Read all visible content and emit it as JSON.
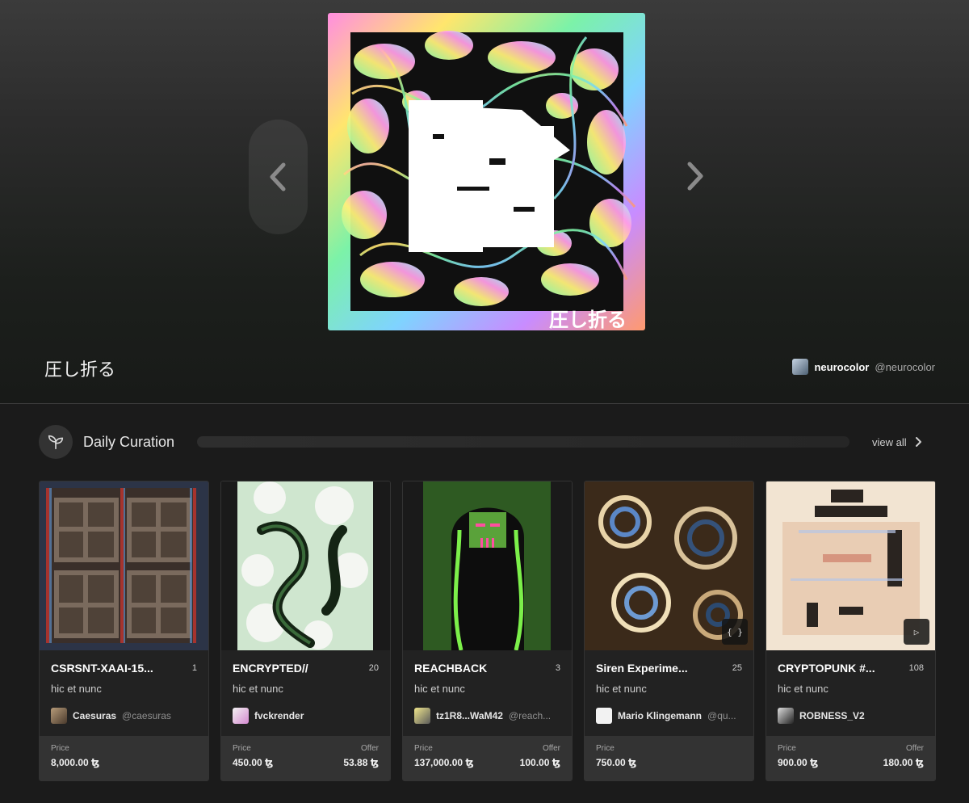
{
  "hero": {
    "title": "圧し折る",
    "artwork_caption": "圧し折る",
    "artist": {
      "name": "neurocolor",
      "handle": "@neurocolor"
    }
  },
  "section": {
    "title": "Daily Curation",
    "view_all": "view all"
  },
  "cards": [
    {
      "title": "CSRSNT-XAAI-15...",
      "count": "1",
      "platform": "hic et nunc",
      "creator_name": "Caesuras",
      "creator_handle": "@caesuras",
      "price_label": "Price",
      "price": "8,000.00 ꜩ",
      "offer_label": "",
      "offer": ""
    },
    {
      "title": "ENCRYPTED//",
      "count": "20",
      "platform": "hic et nunc",
      "creator_name": "fvckrender",
      "creator_handle": "",
      "price_label": "Price",
      "price": "450.00 ꜩ",
      "offer_label": "Offer",
      "offer": "53.88 ꜩ"
    },
    {
      "title": "REACHBACK",
      "count": "3",
      "platform": "hic et nunc",
      "creator_name": "tz1R8...WaM42",
      "creator_handle": "@reach...",
      "price_label": "Price",
      "price": "137,000.00 ꜩ",
      "offer_label": "Offer",
      "offer": "100.00 ꜩ"
    },
    {
      "title": "Siren Experime...",
      "count": "25",
      "platform": "hic et nunc",
      "creator_name": "Mario Klingemann",
      "creator_handle": "@qu...",
      "price_label": "Price",
      "price": "750.00 ꜩ",
      "offer_label": "",
      "offer": "",
      "badge": "{ }"
    },
    {
      "title": "CRYPTOPUNK #...",
      "count": "108",
      "platform": "hic et nunc",
      "creator_name": "ROBNESS_V2",
      "creator_handle": "",
      "price_label": "Price",
      "price": "900.00 ꜩ",
      "offer_label": "Offer",
      "offer": "180.00 ꜩ",
      "badge": "▷"
    }
  ],
  "icons": {
    "hero_prev": "chevron-left-icon",
    "hero_next": "chevron-right-icon",
    "section": "sprout-icon",
    "view_all": "chevron-right-icon"
  }
}
